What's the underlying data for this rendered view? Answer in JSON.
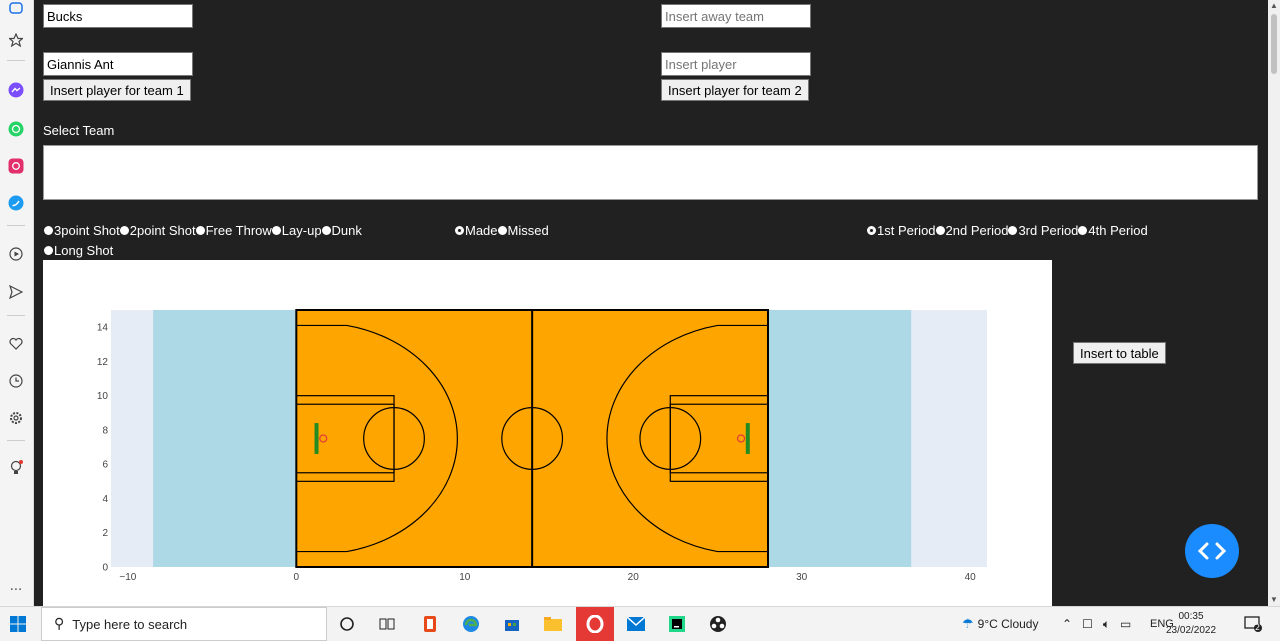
{
  "team1": {
    "team_value": "Bucks",
    "player_value": "Giannis Ant",
    "insert_button": "Insert player for team 1"
  },
  "team2": {
    "team_placeholder": "Insert away team",
    "player_placeholder": "Insert player",
    "insert_button": "Insert player for team 2"
  },
  "select_team_label": "Select Team",
  "shot_types": [
    "3point Shot",
    "2point Shot",
    "Free Throw",
    "Lay-up",
    "Dunk",
    "Long Shot"
  ],
  "outcomes": [
    "Made",
    "Missed"
  ],
  "outcome_selected": "Made",
  "periods": [
    "1st Period",
    "2nd Period",
    "3rd Period",
    "4th Period"
  ],
  "period_selected": "1st Period",
  "insert_table_button": "Insert to table",
  "fab_icon": "code-icon",
  "chart_data": {
    "type": "scatter",
    "description_none": "",
    "x_ticks": [
      "−10",
      "0",
      "10",
      "20",
      "30",
      "40"
    ],
    "y_ticks": [
      "0",
      "2",
      "4",
      "6",
      "8",
      "10",
      "12",
      "14"
    ],
    "xlim": [
      -11,
      41
    ],
    "ylim": [
      0,
      15
    ],
    "court_color": "#ffa500",
    "outside_color": "#add8e6",
    "plot_bg": "#e5ecf6"
  },
  "os_sidebar_icons": [
    "app-icon",
    "star-icon",
    "messenger-icon",
    "whatsapp-icon",
    "instagram-icon",
    "twitter-icon",
    "play-icon",
    "send-icon",
    "heart-icon",
    "clock-icon",
    "settings-icon",
    "bulb-icon",
    "more-icon"
  ],
  "taskbar": {
    "search_placeholder": "Type here to search",
    "weather": "9°C  Cloudy",
    "lang": "ENG",
    "time": "00:35",
    "date": "23/02/2022",
    "notif_count": "2"
  }
}
